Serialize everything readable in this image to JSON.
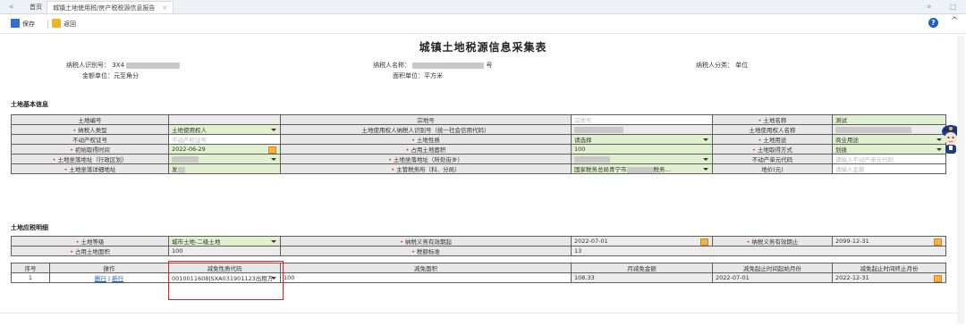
{
  "tabs": {
    "nav_prev": "«",
    "home": "首页",
    "active": "城镇土地使用税/房产税税源信息报告",
    "close": "×",
    "nav_next": "»",
    "window_ctrl": "□"
  },
  "toolbar": {
    "save": "保存",
    "back": "返回",
    "help": "?",
    "collapse": "^"
  },
  "title": "城镇土地税源信息采集表",
  "header": {
    "taxpayer_id_label": "纳税人识别号：",
    "taxpayer_id_value": "3X4",
    "taxpayer_name_label": "纳税人名称：",
    "taxpayer_name_suffix": "号",
    "taxpayer_cat_label": "纳税人分类：",
    "taxpayer_cat_value": "单位",
    "amount_unit": "金额单位：元至角分",
    "area_unit": "面积单位：平方米"
  },
  "basic_section": "土地基本信息",
  "basic": {
    "land_no": "土地编号",
    "parcel_no": "宗地号",
    "parcel_no_ph": "宗地号",
    "land_name": "土地名称",
    "land_name_val": "测试",
    "taxpayer_type": "纳税人类型",
    "taxpayer_type_val": "土地使用权人",
    "user_id_label": "土地使用权人纳税人识别号（统一社会信用代码）",
    "user_name_label": "土地使用权人名称",
    "property_cert": "不动产权证号",
    "property_cert_ph": "不动产权证号",
    "land_nature": "土地性质",
    "land_nature_val": "请选择",
    "land_use": "土地用途",
    "land_use_val": "商业用途",
    "acq_time": "初始取得时间",
    "acq_time_val": "2022-06-29",
    "land_area": "占用土地面积",
    "land_area_val": "100",
    "acq_method": "土地取得方式",
    "acq_method_val": "划拨",
    "address_admin": "土地坐落地址（行政区划）",
    "address_street": "土地坐落地址（所处街乡）",
    "unit_code": "不动产单元代码",
    "unit_code_ph": "请输入不动产单元代码",
    "address_detail": "土地坐落详细地址",
    "address_detail_val": "发",
    "tax_office": "主管税务所（科、分局）",
    "tax_office_val": "国家税务总局青宁市",
    "tax_office_suffix": "税务…",
    "land_price": "地价(元)",
    "land_price_ph": "请输入金额"
  },
  "detail_section": "土地应税明细",
  "detail": {
    "land_grade": "土地等级",
    "land_grade_val": "城市土地-二级土地",
    "tax_start": "纳税义务有效期起",
    "tax_start_val": "2022-07-01",
    "tax_end": "纳税义务有效期止",
    "tax_end_val": "2099-12-31",
    "occupied_area": "占用土地面积",
    "occupied_area_val": "100",
    "tax_std": "税额标准",
    "tax_std_val": "13"
  },
  "relief": {
    "columns": [
      "序号",
      "操作",
      "减免性质代码",
      "减免面积",
      "月减免金额",
      "减免起止时间起始月份",
      "减免起止时间终止月份"
    ],
    "rows": [
      {
        "no": "1",
        "op_delete": "删行",
        "op_sep": "|",
        "op_add": "新行",
        "code": "0010011608|SXA031901123出租方",
        "area": "100",
        "monthly": "108.33",
        "start": "2022-07-01",
        "end": "2022-12-31"
      }
    ]
  }
}
